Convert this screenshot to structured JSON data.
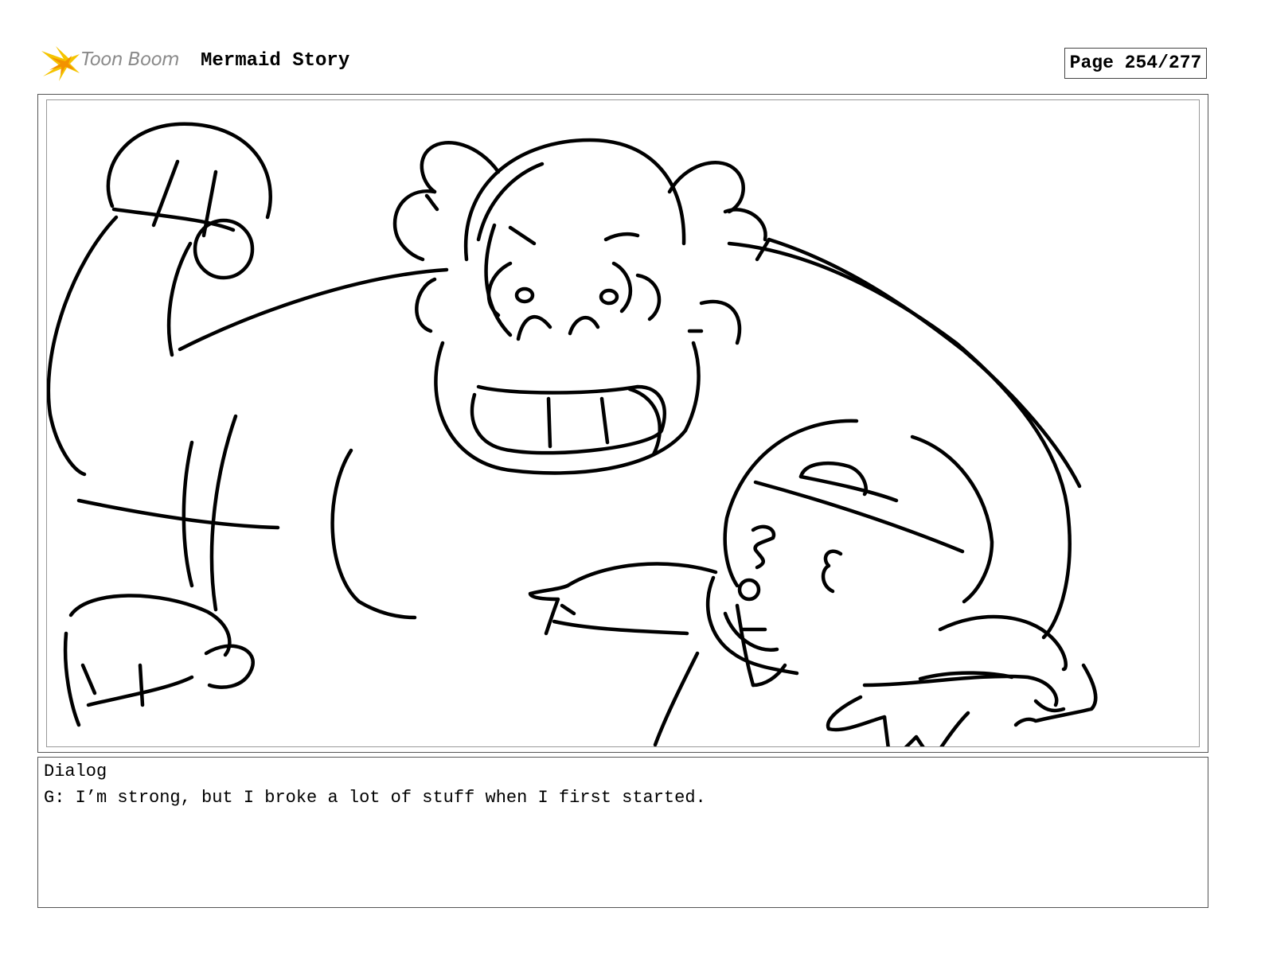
{
  "header": {
    "brand": "Toon Boom",
    "project_title": "Mermaid Story",
    "page_label": "Page 254/277"
  },
  "panel": {
    "image_description_icon": "storyboard-sketch"
  },
  "dialog": {
    "label": "Dialog",
    "text": "G: I’m strong, but I broke a lot of stuff when I first started."
  },
  "colors": {
    "logo_yellow": "#f5c400",
    "logo_orange": "#f39200",
    "logo_text": "#8a8a8a",
    "ink": "#000000"
  }
}
